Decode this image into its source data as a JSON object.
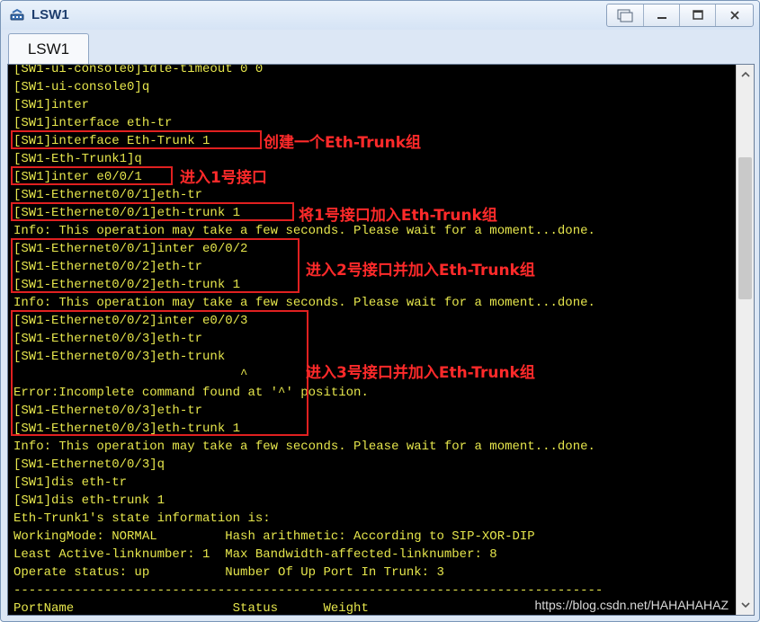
{
  "window": {
    "title": "LSW1",
    "icon": "switch-device-icon",
    "controls": [
      "restore-window-icon",
      "minimize-icon",
      "maximize-icon",
      "close-icon"
    ]
  },
  "tabs": [
    {
      "label": "LSW1",
      "active": true
    }
  ],
  "console": {
    "lines": [
      "[SW1-ui-console0]idle-timeout 0 0",
      "[SW1-ui-console0]q",
      "[SW1]inter",
      "[SW1]interface eth-tr",
      "[SW1]interface Eth-Trunk 1",
      "[SW1-Eth-Trunk1]q",
      "[SW1]inter e0/0/1",
      "[SW1-Ethernet0/0/1]eth-tr",
      "[SW1-Ethernet0/0/1]eth-trunk 1",
      "Info: This operation may take a few seconds. Please wait for a moment...done.",
      "[SW1-Ethernet0/0/1]inter e0/0/2",
      "[SW1-Ethernet0/0/2]eth-tr",
      "[SW1-Ethernet0/0/2]eth-trunk 1",
      "Info: This operation may take a few seconds. Please wait for a moment...done.",
      "[SW1-Ethernet0/0/2]inter e0/0/3",
      "[SW1-Ethernet0/0/3]eth-tr",
      "[SW1-Ethernet0/0/3]eth-trunk",
      "                              ^",
      "Error:Incomplete command found at '^' position.",
      "[SW1-Ethernet0/0/3]eth-tr",
      "[SW1-Ethernet0/0/3]eth-trunk 1",
      "Info: This operation may take a few seconds. Please wait for a moment...done.",
      "[SW1-Ethernet0/0/3]q",
      "[SW1]dis eth-tr",
      "[SW1]dis eth-trunk 1",
      "Eth-Trunk1's state information is:",
      "WorkingMode: NORMAL         Hash arithmetic: According to SIP-XOR-DIP",
      "Least Active-linknumber: 1  Max Bandwidth-affected-linknumber: 8",
      "Operate status: up          Number Of Up Port In Trunk: 3",
      "------------------------------------------------------------------------------",
      "PortName                     Status      Weight"
    ],
    "text_color": "#e6e64c",
    "background": "#000000"
  },
  "annotations": [
    {
      "text": "创建一个Eth-Trunk组"
    },
    {
      "text": "进入1号接口"
    },
    {
      "text": "将1号接口加入Eth-Trunk组"
    },
    {
      "text": "进入2号接口并加入Eth-Trunk组"
    },
    {
      "text": "进入3号接口并加入Eth-Trunk组"
    }
  ],
  "highlight_color": "#e02020",
  "watermark": "https://blog.csdn.net/HAHAHAHAZ"
}
